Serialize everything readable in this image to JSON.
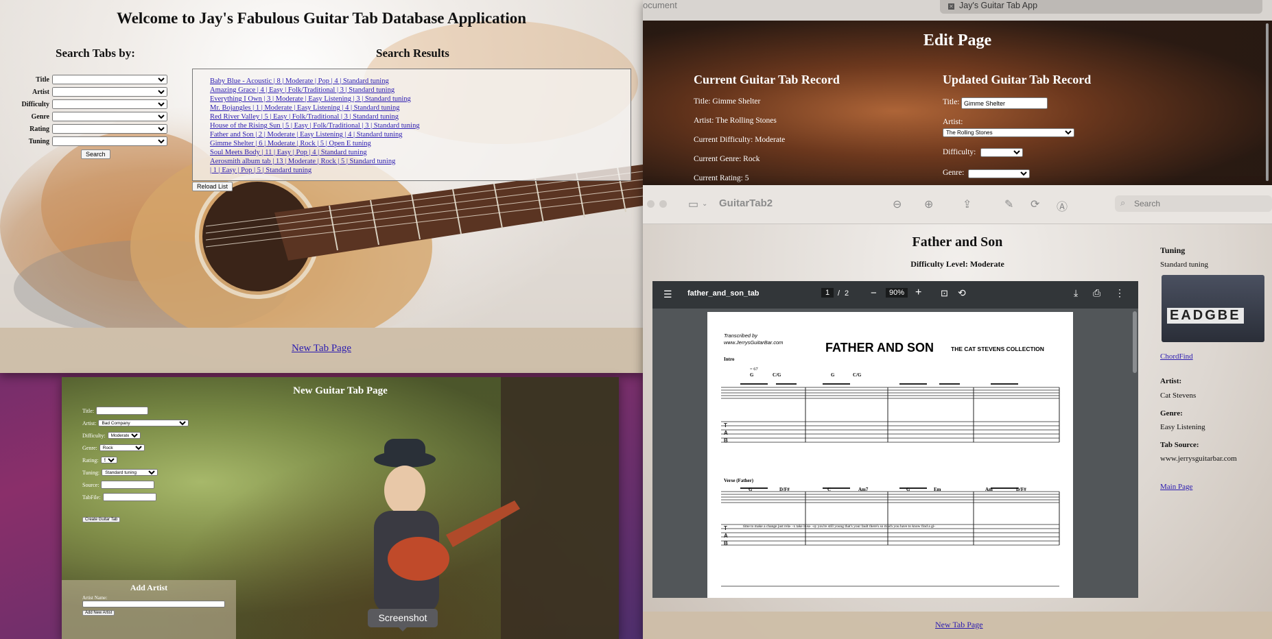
{
  "main": {
    "title": "Welcome to Jay's Fabulous Guitar Tab Database Application",
    "search_heading": "Search Tabs by:",
    "results_heading": "Search Results",
    "fields": [
      "Title",
      "Artist",
      "Difficulty",
      "Genre",
      "Rating",
      "Tuning"
    ],
    "search_button": "Search",
    "results": [
      "Baby Blue - Acoustic | 8 | Moderate | Pop | 4 | Standard tuning",
      "Amazing Grace | 4 | Easy | Folk/Traditional | 3 | Standard tuning",
      "Everything I Own | 3 | Moderate | Easy Listening | 3 | Standard tuning",
      "Mr. Bojangles | 1 | Moderate | Easy Listening | 4 | Standard tuning",
      "Red River Valley | 5 | Easy | Folk/Traditional | 3 | Standard tuning",
      "House of the Rising Sun | 5 | Easy | Folk/Traditional | 3 | Standard tuning",
      "Father and Son | 2 | Moderate | Easy Listening | 4 | Standard tuning",
      "Gimme Shelter | 6 | Moderate | Rock | 5 | Open E tuning",
      "Soul Meets Body | 11 | Easy | Pop | 4 | Standard tuning",
      "Aerosmith album tab | 13 | Moderate | Rock | 5 | Standard tuning",
      "| 1 | Easy | Pop | 5 | Standard tuning"
    ],
    "reload_button": "Reload List",
    "footer_link": "New Tab Page"
  },
  "edit": {
    "browser_doc": "ocument",
    "browser_tab": "Jay's Guitar Tab App",
    "title": "Edit Page",
    "current_heading": "Current Guitar Tab Record",
    "updated_heading": "Updated Guitar Tab Record",
    "current": [
      "Title: Gimme Shelter",
      "Artist: The Rolling Stones",
      "Current Difficulty: Moderate",
      "Current Genre: Rock",
      "Current Rating: 5"
    ],
    "title_label": "Title:",
    "title_value": "Gimme Shelter",
    "artist_label": "Artist:",
    "artist_value": "The Rolling Stones",
    "difficulty_label": "Difficulty:",
    "genre_label": "Genre:"
  },
  "newtab": {
    "title": "New Guitar Tab Page",
    "labels": [
      "Title:",
      "Artist:",
      "Difficulty:",
      "Genre:",
      "Rating:",
      "Tuning:",
      "Source:",
      "TabFile:"
    ],
    "artist_value": "Bad Company",
    "difficulty_value": "Moderate",
    "genre_value": "Rock",
    "rating_value": "5",
    "tuning_value": "Standard tuning",
    "create_button": "Create Guitar Tab",
    "add_artist_heading": "Add Artist",
    "artist_name_label": "Artist Name:",
    "add_artist_button": "Add New Artist"
  },
  "viewer": {
    "app_name": "GuitarTab2",
    "search_placeholder": "Search",
    "song_title": "Father and Son",
    "difficulty": "Difficulty Level: Moderate",
    "pdf": {
      "filename": "father_and_son_tab",
      "page_current": "1",
      "page_sep": "/",
      "page_total": "2",
      "zoom": "90%",
      "sheet_credit_1": "Transcribed by",
      "sheet_credit_2": "www.JerrysGuitarBar.com",
      "sheet_title": "FATHER AND SON",
      "sheet_subtitle": "THE CAT STEVENS COLLECTION",
      "section_a": "Intro",
      "section_b": "Verse (Father)",
      "tempo": "= 67",
      "chords_a": [
        "G",
        "C/G",
        "G",
        "C/G"
      ],
      "chords_b": [
        "G",
        "D/F#",
        "C",
        "Am7",
        "G",
        "Em",
        "Am",
        "D/F#"
      ],
      "lyrics": "time to make a change just rela- -x take it ea- -sy you're still young that's your fault there's so much you have to know find a gi-"
    },
    "tuning_heading": "Tuning",
    "tuning_value": "Standard tuning",
    "tuning_image_text": "EADGBE",
    "chordfind_link": "ChordFind",
    "artist_heading": "Artist:",
    "artist_value": "Cat Stevens",
    "genre_heading": "Genre:",
    "genre_value": "Easy Listening",
    "source_heading": "Tab Source:",
    "source_value": "www.jerrysguitarbar.com",
    "main_link": "Main Page",
    "footer_link": "New Tab Page"
  },
  "tooltip": "Screenshot"
}
